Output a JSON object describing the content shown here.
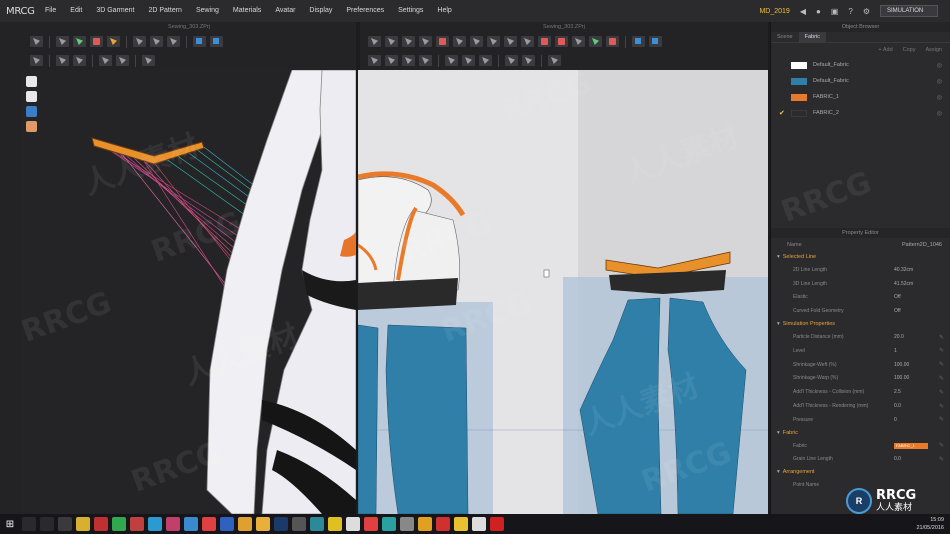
{
  "app": {
    "logo": "MRCG"
  },
  "menu": [
    "File",
    "Edit",
    "3D Garment",
    "2D Pattern",
    "Sewing",
    "Materials",
    "Avatar",
    "Display",
    "Preferences",
    "Settings",
    "Help"
  ],
  "header": {
    "user": "MD_2019",
    "mode": "SIMULATION"
  },
  "windows": {
    "view3d_title": "Sewing_303.ZPrj",
    "view2d_title": "Sewing_303.ZPrj"
  },
  "object_browser": {
    "title": "Object Browser",
    "tabs": [
      "Scene",
      "Fabric"
    ],
    "actions": [
      "+ Add",
      "Copy",
      "Assign"
    ],
    "fabrics": [
      {
        "name": "Default_Fabric",
        "color": "#ffffff",
        "active": false
      },
      {
        "name": "Default_Fabric",
        "color": "#2f7fa8",
        "active": false
      },
      {
        "name": "FABRIC_1",
        "color": "#e87a2a",
        "active": false
      },
      {
        "name": "FABRIC_2",
        "color": "#2b2b2e",
        "active": true
      }
    ]
  },
  "property_editor": {
    "title": "Property Editor",
    "name_label": "Name",
    "name_value": "Pattern2D_1046",
    "sections": [
      {
        "title": "Selected Line",
        "props": [
          {
            "label": "2D Line Length",
            "value": "40.32cm"
          },
          {
            "label": "3D Line Length",
            "value": "41.52cm"
          },
          {
            "label": "Elastic",
            "value": "Off"
          },
          {
            "label": "Curved Fold Geometry",
            "value": "Off"
          }
        ]
      },
      {
        "title": "Simulation Properties",
        "props": [
          {
            "label": "Particle Distance (mm)",
            "value": "20.0"
          },
          {
            "label": "Level",
            "value": "1"
          },
          {
            "label": "Shrinkage-Weft (%)",
            "value": "100.00"
          },
          {
            "label": "Shrinkage-Warp (%)",
            "value": "100.00"
          },
          {
            "label": "Add'l Thickness - Collision (mm)",
            "value": "2.5"
          },
          {
            "label": "Add'l Thickness - Rendering (mm)",
            "value": "0.0"
          },
          {
            "label": "Pressure",
            "value": "0"
          }
        ]
      },
      {
        "title": "Fabric",
        "props": [
          {
            "label": "Fabric",
            "value": "FABRIC_1"
          },
          {
            "label": "Grain Line Length",
            "value": "0.0"
          }
        ]
      },
      {
        "title": "Arrangement",
        "props": [
          {
            "label": "Point Name",
            "value": ""
          }
        ]
      }
    ]
  },
  "taskbar": {
    "time": "15:09",
    "date": "21/05/2016"
  },
  "watermark": {
    "brand": "RRCG",
    "cn": "人人素材"
  },
  "colors": {
    "accent_orange": "#e87a2a",
    "fabric_blue": "#2f7fa8",
    "avatar_white": "#f0f0f4"
  }
}
